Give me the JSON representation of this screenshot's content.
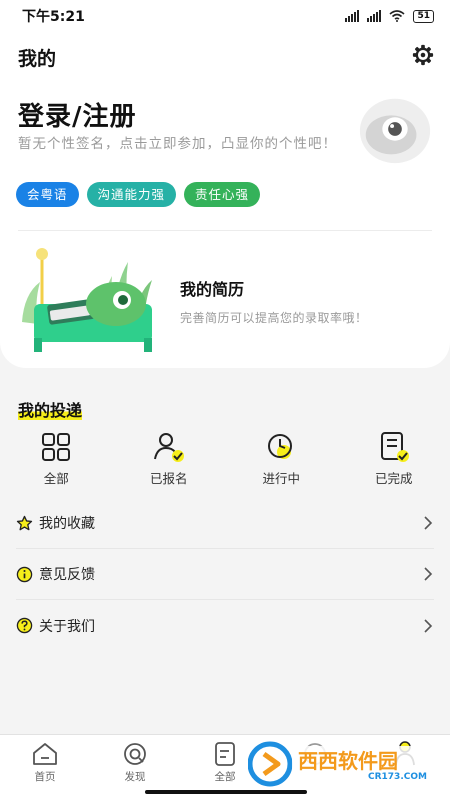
{
  "status_bar": {
    "time": "下午5:21",
    "battery": "51"
  },
  "header": {
    "title": "我的"
  },
  "profile": {
    "login_title": "登录/注册",
    "signature": "暂无个性签名，点击立即参加，凸显你的个性吧！",
    "tags": [
      {
        "label": "会粤语",
        "color": "#1a82e6"
      },
      {
        "label": "沟通能力强",
        "color": "#26b1a6"
      },
      {
        "label": "责任心强",
        "color": "#34b25a"
      }
    ]
  },
  "resume": {
    "title": "我的简历",
    "desc": "完善简历可以提高您的录取率哦！"
  },
  "delivery": {
    "title": "我的投递",
    "items": [
      {
        "label": "全部",
        "icon": "grid-icon"
      },
      {
        "label": "已报名",
        "icon": "person-check-icon"
      },
      {
        "label": "进行中",
        "icon": "clock-icon"
      },
      {
        "label": "已完成",
        "icon": "document-check-icon"
      }
    ]
  },
  "menu": [
    {
      "label": "我的收藏",
      "icon": "star-icon"
    },
    {
      "label": "意见反馈",
      "icon": "info-icon"
    },
    {
      "label": "关于我们",
      "icon": "question-icon"
    }
  ],
  "tabs": [
    {
      "label": "首页",
      "icon": "home-icon"
    },
    {
      "label": "发现",
      "icon": "discover-icon"
    },
    {
      "label": "全部",
      "icon": "all-icon"
    },
    {
      "label": "",
      "icon": "message-icon"
    },
    {
      "label": "",
      "icon": "profile-icon"
    }
  ],
  "watermark": {
    "brand": "西西软件园",
    "site": "CR173.COM"
  },
  "colors": {
    "accent_yellow": "#f6ee1a",
    "resume_green": "#2fcf8c",
    "text_gray": "#9a9a9a"
  }
}
